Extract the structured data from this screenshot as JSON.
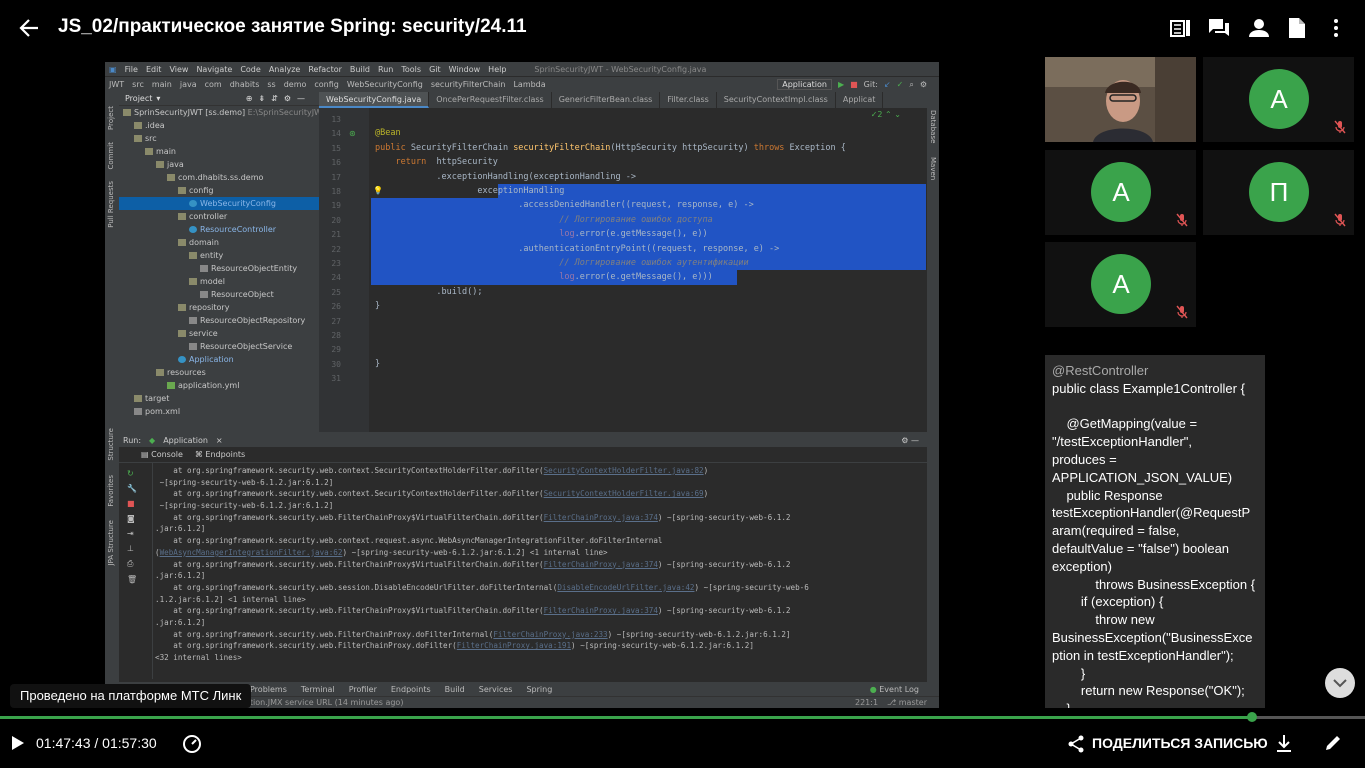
{
  "header": {
    "title": "JS_02/практическое занятие Spring: security/24.11"
  },
  "ide": {
    "menu": [
      "File",
      "Edit",
      "View",
      "Navigate",
      "Code",
      "Analyze",
      "Refactor",
      "Build",
      "Run",
      "Tools",
      "Git",
      "Window",
      "Help"
    ],
    "window_title": "SprinSecurityJWT - WebSecurityConfig.java",
    "breadcrumb": [
      "JWT",
      "src",
      "main",
      "java",
      "com",
      "dhabits",
      "ss",
      "demo",
      "config",
      "WebSecurityConfig",
      "securityFilterChain",
      "Lambda"
    ],
    "run_config": "Application",
    "git_label": "Git:",
    "project_label": "Project",
    "tabs": [
      "WebSecurityConfig.java",
      "OncePerRequestFilter.class",
      "GenericFilterBean.class",
      "Filter.class",
      "SecurityContextImpl.class",
      "Applicat"
    ],
    "inspection_count": "2",
    "tree": [
      {
        "label": "SprinSecurityJWT [ss.demo]",
        "extra": "E:\\SprinSecurityJW",
        "indent": 0,
        "type": "folder"
      },
      {
        "label": ".idea",
        "indent": 1,
        "type": "folder"
      },
      {
        "label": "src",
        "indent": 1,
        "type": "folder"
      },
      {
        "label": "main",
        "indent": 2,
        "type": "folder"
      },
      {
        "label": "java",
        "indent": 3,
        "type": "folder"
      },
      {
        "label": "com.dhabits.ss.demo",
        "indent": 4,
        "type": "folder"
      },
      {
        "label": "config",
        "indent": 5,
        "type": "folder"
      },
      {
        "label": "WebSecurityConfig",
        "indent": 6,
        "type": "class",
        "selected": true
      },
      {
        "label": "controller",
        "indent": 5,
        "type": "folder"
      },
      {
        "label": "ResourceController",
        "indent": 6,
        "type": "class"
      },
      {
        "label": "domain",
        "indent": 5,
        "type": "folder"
      },
      {
        "label": "entity",
        "indent": 6,
        "type": "folder"
      },
      {
        "label": "ResourceObjectEntity",
        "indent": 7,
        "type": "plain"
      },
      {
        "label": "model",
        "indent": 6,
        "type": "folder"
      },
      {
        "label": "ResourceObject",
        "indent": 7,
        "type": "plain"
      },
      {
        "label": "repository",
        "indent": 5,
        "type": "folder"
      },
      {
        "label": "ResourceObjectRepository",
        "indent": 6,
        "type": "plain"
      },
      {
        "label": "service",
        "indent": 5,
        "type": "folder"
      },
      {
        "label": "ResourceObjectService",
        "indent": 6,
        "type": "plain"
      },
      {
        "label": "Application",
        "indent": 5,
        "type": "class"
      },
      {
        "label": "resources",
        "indent": 3,
        "type": "folder"
      },
      {
        "label": "application.yml",
        "indent": 4,
        "type": "yml"
      },
      {
        "label": "target",
        "indent": 1,
        "type": "folder"
      },
      {
        "label": "pom.xml",
        "indent": 1,
        "type": "plain"
      }
    ],
    "line_numbers": [
      "13",
      "14",
      "15",
      "16",
      "17",
      "18",
      "19",
      "20",
      "21",
      "22",
      "23",
      "24",
      "25",
      "26",
      "27",
      "28",
      "29",
      "30",
      "31"
    ],
    "code_lines": [
      "",
      "@Bean",
      "public SecurityFilterChain securityFilterChain(HttpSecurity httpSecurity) throws Exception {",
      "    return  httpSecurity",
      "            .exceptionHandling(exceptionHandling ->",
      "                    exceptionHandling",
      "                            .accessDeniedHandler((request, response, e) ->",
      "                                    // Логгирование ошибок доступа",
      "                                    log.error(e.getMessage(), e))",
      "                            .authenticationEntryPoint((request, response, e) ->",
      "                                    // Логгирование ошибок аутентификации",
      "                                    log.error(e.getMessage(), e)))",
      "            .build();",
      "}",
      "",
      "",
      "",
      "}",
      ""
    ],
    "run_label": "Run:",
    "run_tab": "Application",
    "console_tabs": [
      "Console",
      "Endpoints"
    ],
    "console_lines": [
      "    at org.springframework.security.web.context.SecurityContextHolderFilter.doFilter(SecurityContextHolderFilter.java:82)",
      " ~[spring-security-web-6.1.2.jar:6.1.2]",
      "    at org.springframework.security.web.context.SecurityContextHolderFilter.doFilter(SecurityContextHolderFilter.java:69)",
      " ~[spring-security-web-6.1.2.jar:6.1.2]",
      "    at org.springframework.security.web.FilterChainProxy$VirtualFilterChain.doFilter(FilterChainProxy.java:374) ~[spring-security-web-6.1.2",
      ".jar:6.1.2]",
      "    at org.springframework.security.web.context.request.async.WebAsyncManagerIntegrationFilter.doFilterInternal",
      "(WebAsyncManagerIntegrationFilter.java:62) ~[spring-security-web-6.1.2.jar:6.1.2] <1 internal line>",
      "    at org.springframework.security.web.FilterChainProxy$VirtualFilterChain.doFilter(FilterChainProxy.java:374) ~[spring-security-web-6.1.2",
      ".jar:6.1.2]",
      "    at org.springframework.security.web.session.DisableEncodeUrlFilter.doFilterInternal(DisableEncodeUrlFilter.java:42) ~[spring-security-web-6",
      ".1.2.jar:6.1.2] <1 internal line>",
      "    at org.springframework.security.web.FilterChainProxy$VirtualFilterChain.doFilter(FilterChainProxy.java:374) ~[spring-security-web-6.1.2",
      ".jar:6.1.2]",
      "    at org.springframework.security.web.FilterChainProxy.doFilterInternal(FilterChainProxy.java:233) ~[spring-security-web-6.1.2.jar:6.1.2]",
      "    at org.springframework.security.web.FilterChainProxy.doFilter(FilterChainProxy.java:191) ~[spring-security-web-6.1.2.jar:6.1.2]",
      "<32 internal lines>"
    ],
    "tool_tabs": [
      "Problems",
      "Terminal",
      "Profiler",
      "Endpoints",
      "Build",
      "Services",
      "Spring"
    ],
    "event_log": "Event Log",
    "status_text": "ation.JMX service URL (14 minutes ago)",
    "status_pos": "221:1",
    "status_branch": "master",
    "side_labels": [
      "Project",
      "Commit",
      "Pull Requests",
      "Structure",
      "Favorites",
      "JPA Structure",
      "Database",
      "Maven"
    ]
  },
  "participants": [
    {
      "initial": "",
      "video": true,
      "muted": false
    },
    {
      "initial": "A",
      "video": false,
      "muted": true
    },
    {
      "initial": "A",
      "video": false,
      "muted": true
    },
    {
      "initial": "П",
      "video": false,
      "muted": true
    },
    {
      "initial": "A",
      "video": false,
      "muted": true
    }
  ],
  "chat": {
    "lines": [
      "@RestController",
      "public class Example1Controller {",
      "",
      "    @GetMapping(value =",
      "\"/testExceptionHandler\",",
      "produces =",
      "APPLICATION_JSON_VALUE)",
      "    public Response",
      "testExceptionHandler(@RequestP",
      "aram(required = false,",
      "defaultValue = \"false\") boolean",
      "exception)",
      "            throws BusinessException {",
      "        if (exception) {",
      "            throw new",
      "BusinessException(\"BusinessExce",
      "ption in testExceptionHandler\");",
      "        }",
      "        return new Response(\"OK\");",
      "    }"
    ]
  },
  "toast": "Проведено на платформе МТС Линк",
  "player": {
    "current_time": "01:47:43",
    "total_time": "01:57:30",
    "progress": 0.917,
    "share_label": "ПОДЕЛИТЬСЯ ЗАПИСЬЮ"
  },
  "colors": {
    "accent": "#3aa34b",
    "selection": "#2154c4",
    "background": "#000000"
  }
}
